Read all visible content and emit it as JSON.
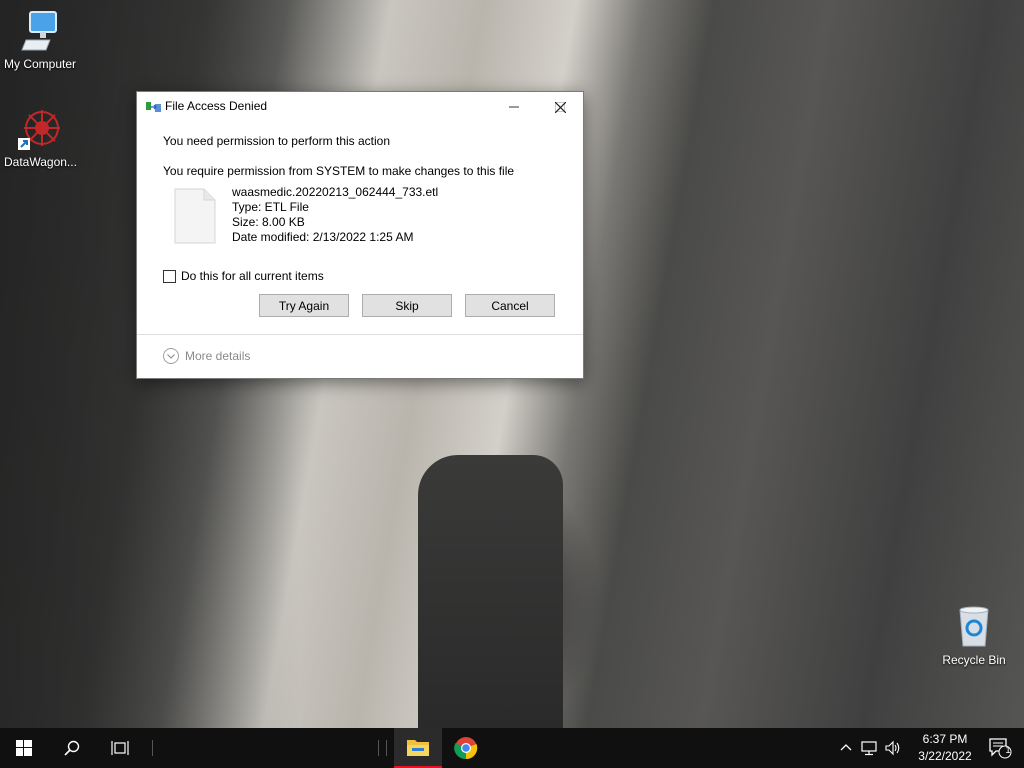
{
  "desktop": {
    "icons": [
      {
        "label": "My Computer",
        "icon": "computer-icon"
      },
      {
        "label": "DataWagon...",
        "icon": "datawagon-shortcut-icon"
      },
      {
        "label": "Recycle Bin",
        "icon": "recycle-bin-icon"
      }
    ]
  },
  "dialog": {
    "title": "File Access Denied",
    "heading": "You need permission to perform this action",
    "message": "You require permission from SYSTEM to make changes to this file",
    "file": {
      "name": "waasmedic.20220213_062444_733.etl",
      "type": "Type: ETL File",
      "size": "Size: 8.00 KB",
      "modified": "Date modified: 2/13/2022 1:25 AM"
    },
    "checkbox_label": "Do this for all current items",
    "checkbox_checked": false,
    "buttons": {
      "try_again": "Try Again",
      "skip": "Skip",
      "cancel": "Cancel"
    },
    "more_details": "More details"
  },
  "taskbar": {
    "pinned": [
      "start-icon",
      "search-icon",
      "task-view-icon",
      "file-explorer-icon",
      "chrome-icon"
    ],
    "clock": {
      "time": "6:37 PM",
      "date": "3/22/2022"
    },
    "notification_count": "1"
  },
  "colors": {
    "taskbar": "#101010",
    "active_underline": "#e81123",
    "button_face": "#e1e1e1"
  }
}
